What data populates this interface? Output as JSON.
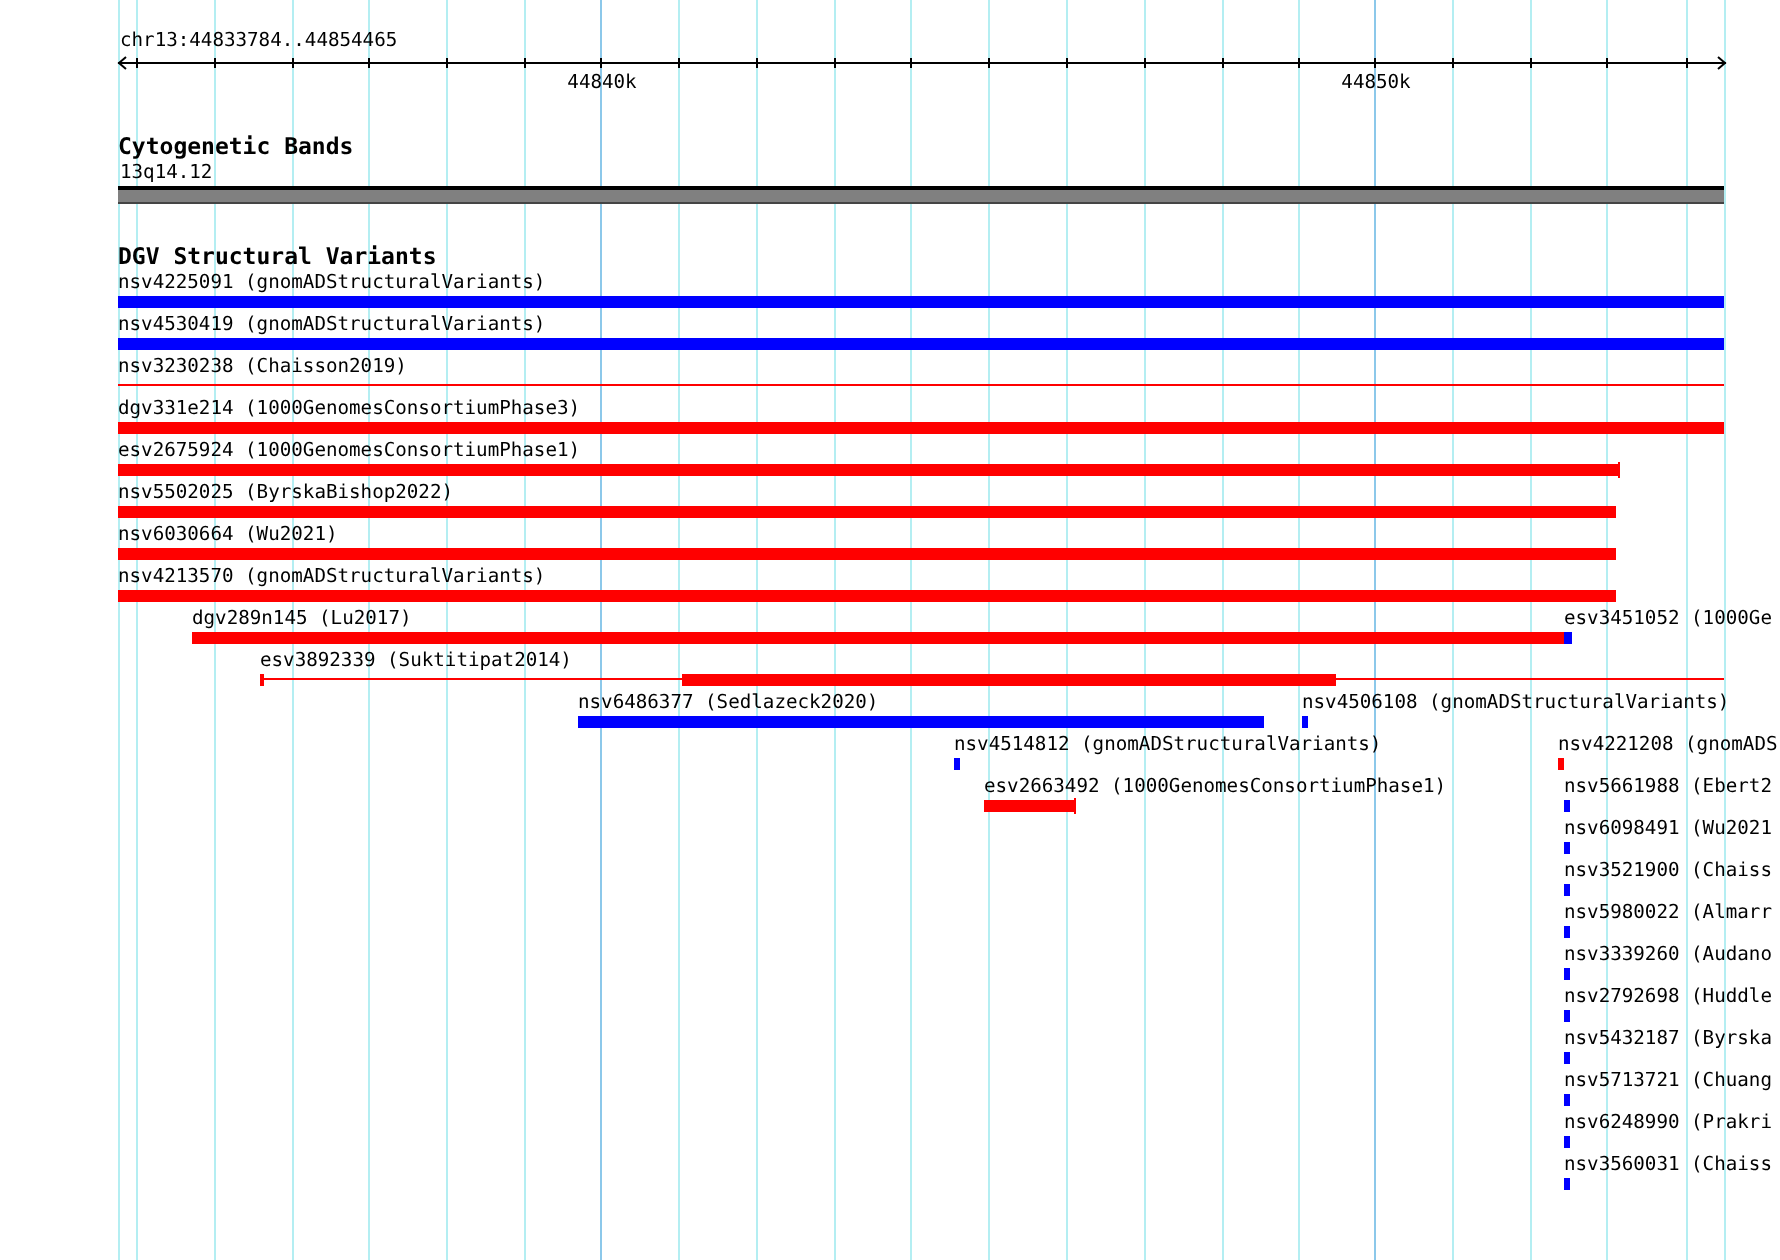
{
  "ruler": {
    "location": "chr13:44833784..44854465",
    "ticks": [
      "44840k",
      "44850k"
    ]
  },
  "cytoband": {
    "title": "Cytogenetic Bands",
    "label": "13q14.12"
  },
  "variants": {
    "title": "DGV Structural Variants",
    "lanes": [
      {
        "features": [
          {
            "label": "nsv4225091 (gnomADStructuralVariants)",
            "color": "#0000ff",
            "kind": "bar"
          }
        ]
      },
      {
        "features": [
          {
            "label": "nsv4530419 (gnomADStructuralVariants)",
            "color": "#0000ff",
            "kind": "bar"
          }
        ]
      },
      {
        "features": [
          {
            "label": "nsv3230238 (Chaisson2019)",
            "color": "#ff0000",
            "kind": "line"
          }
        ]
      },
      {
        "features": [
          {
            "label": "dgv331e214 (1000GenomesConsortiumPhase3)",
            "color": "#ff0000",
            "kind": "bar"
          }
        ]
      },
      {
        "features": [
          {
            "label": "esv2675924 (1000GenomesConsortiumPhase1)",
            "color": "#ff0000",
            "kind": "bar"
          }
        ]
      },
      {
        "features": [
          {
            "label": "nsv5502025 (ByrskaBishop2022)",
            "color": "#ff0000",
            "kind": "bar"
          }
        ]
      },
      {
        "features": [
          {
            "label": "nsv6030664 (Wu2021)",
            "color": "#ff0000",
            "kind": "bar"
          }
        ]
      },
      {
        "features": [
          {
            "label": "nsv4213570 (gnomADStructuralVariants)",
            "color": "#ff0000",
            "kind": "bar"
          }
        ]
      },
      {
        "features": [
          {
            "label": "dgv289n145 (Lu2017)",
            "color": "#ff0000",
            "kind": "bar"
          },
          {
            "label": "esv3451052 (1000Ge",
            "color": "#0000ff",
            "kind": "bar"
          }
        ]
      },
      {
        "features": [
          {
            "label": "esv3892339 (Suktitipat2014)",
            "color": "#ff0000",
            "kind": "split"
          }
        ]
      },
      {
        "features": [
          {
            "label": "nsv6486377 (Sedlazeck2020)",
            "color": "#0000ff",
            "kind": "bar"
          },
          {
            "label": "nsv4506108 (gnomADStructuralVariants)",
            "color": "#0000ff",
            "kind": "bar"
          }
        ]
      },
      {
        "features": [
          {
            "label": "nsv4514812 (gnomADStructuralVariants)",
            "color": "#0000ff",
            "kind": "bar"
          },
          {
            "label": "nsv4221208 (gnomADS",
            "color": "#ff0000",
            "kind": "bar"
          }
        ]
      },
      {
        "features": [
          {
            "label": "esv2663492 (1000GenomesConsortiumPhase1)",
            "color": "#ff0000",
            "kind": "bar"
          },
          {
            "label": "nsv5661988 (Ebert2",
            "color": "#0000ff",
            "kind": "bar"
          }
        ]
      },
      {
        "features": [
          {
            "label": "nsv6098491 (Wu2021",
            "color": "#0000ff",
            "kind": "bar"
          }
        ]
      },
      {
        "features": [
          {
            "label": "nsv3521900 (Chaiss",
            "color": "#0000ff",
            "kind": "bar"
          }
        ]
      },
      {
        "features": [
          {
            "label": "nsv5980022 (Almarr",
            "color": "#0000ff",
            "kind": "bar"
          }
        ]
      },
      {
        "features": [
          {
            "label": "nsv3339260 (Audano",
            "color": "#0000ff",
            "kind": "bar"
          }
        ]
      },
      {
        "features": [
          {
            "label": "nsv2792698 (Huddle",
            "color": "#0000ff",
            "kind": "bar"
          }
        ]
      },
      {
        "features": [
          {
            "label": "nsv5432187 (Byrska",
            "color": "#0000ff",
            "kind": "bar"
          }
        ]
      },
      {
        "features": [
          {
            "label": "nsv5713721 (Chuang",
            "color": "#0000ff",
            "kind": "bar"
          }
        ]
      },
      {
        "features": [
          {
            "label": "nsv6248990 (Prakri",
            "color": "#0000ff",
            "kind": "bar"
          }
        ]
      },
      {
        "features": [
          {
            "label": "nsv3560031 (Chaiss",
            "color": "#0000ff",
            "kind": "bar"
          }
        ]
      }
    ]
  }
}
